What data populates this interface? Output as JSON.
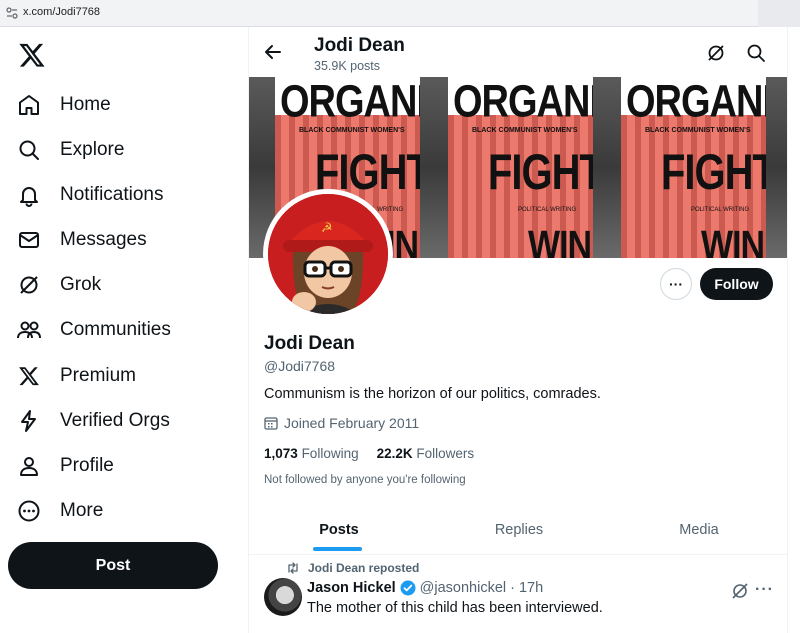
{
  "browser": {
    "url": "x.com/Jodi7768"
  },
  "sidebar": {
    "items": [
      {
        "label": "Home",
        "icon": "home-icon"
      },
      {
        "label": "Explore",
        "icon": "search-icon"
      },
      {
        "label": "Notifications",
        "icon": "bell-icon"
      },
      {
        "label": "Messages",
        "icon": "envelope-icon"
      },
      {
        "label": "Grok",
        "icon": "grok-icon"
      },
      {
        "label": "Communities",
        "icon": "people-icon"
      },
      {
        "label": "Premium",
        "icon": "x-logo-icon"
      },
      {
        "label": "Verified Orgs",
        "icon": "lightning-icon"
      },
      {
        "label": "Profile",
        "icon": "person-icon"
      },
      {
        "label": "More",
        "icon": "more-circle-icon"
      }
    ],
    "post_label": "Post"
  },
  "header": {
    "name": "Jodi Dean",
    "post_count": "35.9K posts"
  },
  "banner": {
    "word1": "ORGANIZE",
    "word2": "FIGHT",
    "word3": "WIN",
    "subtitle": "BLACK COMMUNIST WOMEN'S",
    "subtitle2": "POLITICAL WRITING"
  },
  "profile": {
    "more_label": "···",
    "follow_label": "Follow",
    "name": "Jodi Dean",
    "handle": "@Jodi7768",
    "bio": "Communism is the horizon of our politics, comrades.",
    "joined": "Joined February 2011",
    "following_count": "1,073",
    "following_label": "Following",
    "followers_count": "22.2K",
    "followers_label": "Followers",
    "not_followed": "Not followed by anyone you're following"
  },
  "tabs": [
    {
      "label": "Posts",
      "active": true
    },
    {
      "label": "Replies",
      "active": false
    },
    {
      "label": "Media",
      "active": false
    }
  ],
  "tweet": {
    "repost_text": "Jodi Dean reposted",
    "author": "Jason Hickel",
    "handle": "@jasonhickel",
    "time": "· 17h",
    "text": "The mother of this child has been interviewed.",
    "more_label": "···"
  },
  "colors": {
    "accent": "#1d9bf0",
    "primary_button": "#0f1419",
    "avatar_red": "#c81e20",
    "banner_red": "#e8746a"
  }
}
